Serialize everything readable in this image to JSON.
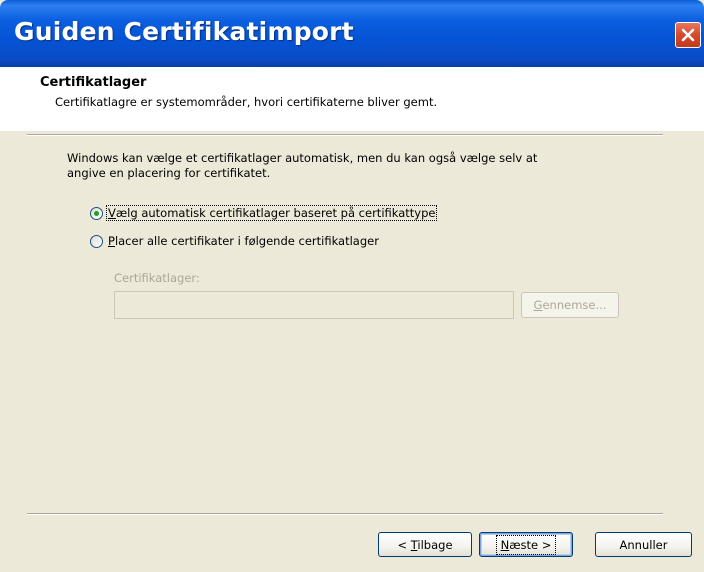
{
  "window": {
    "title": "Guiden Certifikatimport",
    "close_icon": "close-icon"
  },
  "header": {
    "title": "Certifikatlager",
    "subtitle": "Certifikatlagre er systemområder, hvori certifikaterne bliver gemt."
  },
  "body": {
    "intro_line1": "Windows kan vælge et certifikatlager automatisk, men du kan også vælge selv at",
    "intro_line2": "angive en placering for certifikatet.",
    "option_auto": {
      "accel": "V",
      "rest": "ælg automatisk certifikatlager baseret på certifikattype",
      "checked": true
    },
    "option_manual": {
      "accel": "P",
      "rest": "lacer alle certifikater i følgende certifikatlager",
      "checked": false
    },
    "store_label": "Certifikatlager:",
    "store_value": "",
    "browse": {
      "accel": "G",
      "rest": "ennemse..."
    }
  },
  "footer": {
    "back": {
      "prefix": "< ",
      "accel": "T",
      "rest": "ilbage"
    },
    "next": {
      "accel": "N",
      "rest": "æste >"
    },
    "cancel": "Annuller"
  },
  "colors": {
    "titlebar": "#0553d4",
    "dialog_bg": "#ece9d8",
    "close_red": "#d44a2a",
    "radio_checked": "#21a121"
  }
}
